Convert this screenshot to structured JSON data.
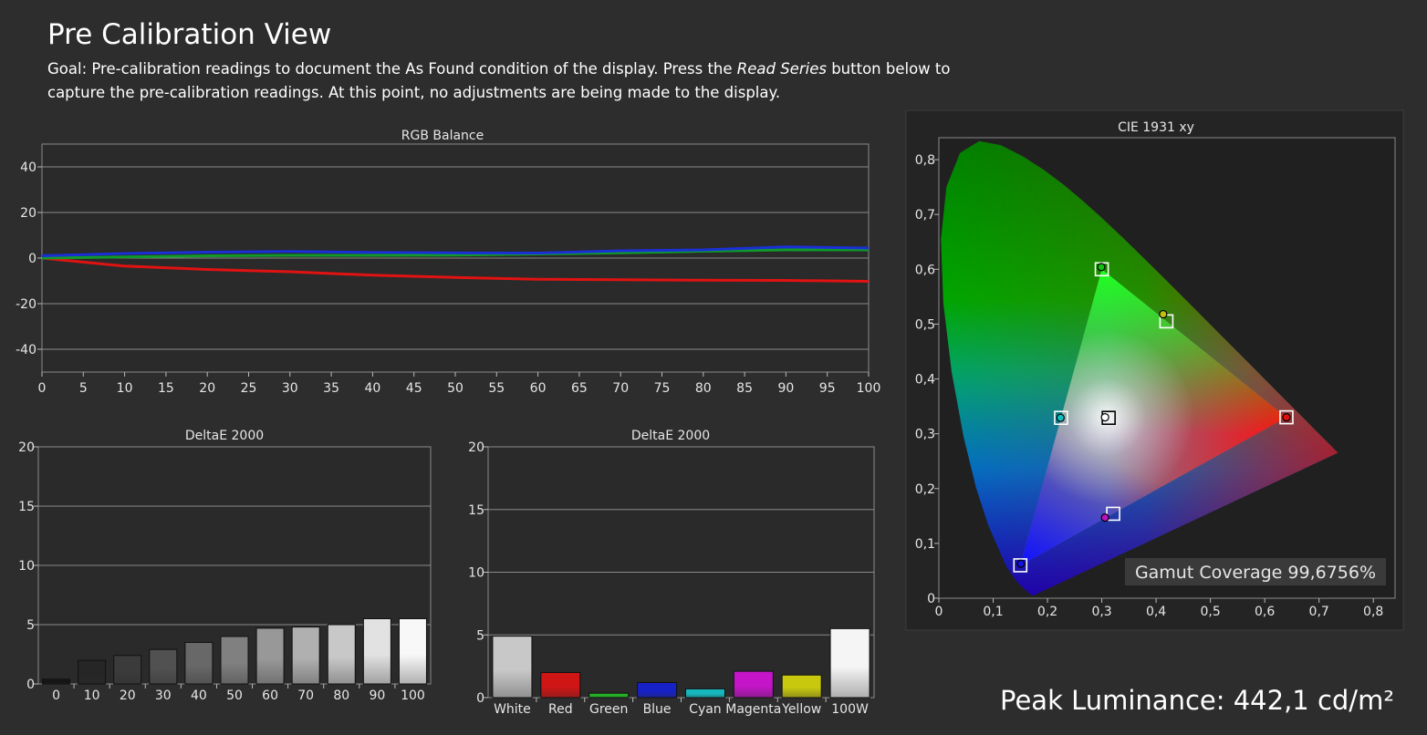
{
  "header": {
    "title": "Pre Calibration View",
    "goal_prefix": "Goal: Pre-calibration readings to document the As Found condition of the display. Press the ",
    "goal_button_ref": "Read Series",
    "goal_suffix": " button below to capture the pre-calibration readings. At this point, no adjustments are being made to the display."
  },
  "colors": {
    "background": "#2d2d2d",
    "plot_bg": "#2a2a2a",
    "red_series": "#e11212",
    "green_series": "#0f9a2a",
    "blue_series": "#1b2fd6"
  },
  "chart_data": [
    {
      "type": "line",
      "title": "RGB Balance",
      "x": [
        0,
        10,
        20,
        30,
        40,
        50,
        60,
        70,
        80,
        90,
        100
      ],
      "xticks": [
        "0",
        "5",
        "10",
        "15",
        "20",
        "25",
        "30",
        "35",
        "40",
        "45",
        "50",
        "55",
        "60",
        "65",
        "70",
        "75",
        "80",
        "85",
        "90",
        "95",
        "100"
      ],
      "yticks": [
        "40",
        "20",
        "0",
        "-20",
        "-40"
      ],
      "xlim": [
        0,
        100
      ],
      "ylim": [
        -50,
        50
      ],
      "grid": true,
      "series": [
        {
          "color": "#e11212",
          "values": [
            0,
            -3.5,
            -5,
            -6,
            -7.5,
            -8.5,
            -9.3,
            -9.5,
            -9.7,
            -9.8,
            -10.2
          ]
        },
        {
          "color": "#0f9a2a",
          "values": [
            0,
            0.5,
            1,
            1.2,
            1.2,
            1.3,
            1.8,
            2.3,
            3,
            3.6,
            3.6
          ]
        },
        {
          "color": "#1b2fd6",
          "values": [
            1,
            2,
            2.6,
            2.9,
            2.5,
            2.3,
            2.2,
            3.2,
            3.6,
            4.9,
            4.4
          ]
        }
      ]
    },
    {
      "type": "bar",
      "title": "DeltaE 2000",
      "categories": [
        "0",
        "10",
        "20",
        "30",
        "40",
        "50",
        "60",
        "70",
        "80",
        "90",
        "100"
      ],
      "values": [
        0.4,
        2.0,
        2.4,
        2.9,
        3.5,
        4.0,
        4.7,
        4.8,
        5.0,
        5.5,
        5.5
      ],
      "bar_colors": [
        "#151515",
        "#262626",
        "#3b3b3b",
        "#515151",
        "#686868",
        "#808080",
        "#989898",
        "#b0b0b0",
        "#c8c8c8",
        "#e2e2e2",
        "#f8f8f8"
      ],
      "yticks": [
        "20",
        "15",
        "10",
        "5",
        "0"
      ],
      "ylim": [
        0,
        20
      ],
      "grid": true
    },
    {
      "type": "bar",
      "title": "DeltaE 2000",
      "categories": [
        "White",
        "Red",
        "Green",
        "Blue",
        "Cyan",
        "Magenta",
        "Yellow",
        "100W"
      ],
      "values": [
        4.9,
        2.0,
        0.35,
        1.2,
        0.7,
        2.1,
        1.8,
        5.5
      ],
      "bar_colors": [
        "#c8c8c8",
        "#d01515",
        "#25b027",
        "#1622c8",
        "#17b7bf",
        "#c515c9",
        "#c8c80f",
        "#f5f5f5"
      ],
      "yticks": [
        "20",
        "15",
        "10",
        "5",
        "0"
      ],
      "ylim": [
        0,
        20
      ],
      "grid": true
    },
    {
      "type": "scatter",
      "title": "CIE 1931 xy",
      "xticks": [
        "0",
        "0,1",
        "0,2",
        "0,3",
        "0,4",
        "0,5",
        "0,6",
        "0,7",
        "0,8"
      ],
      "yticks": [
        "0,8",
        "0,7",
        "0,6",
        "0,5",
        "0,4",
        "0,3",
        "0,2",
        "0,1",
        "0"
      ],
      "xlim": [
        0,
        0.84
      ],
      "ylim": [
        0,
        0.84
      ],
      "targets": [
        {
          "x": 0.64,
          "y": 0.33
        },
        {
          "x": 0.3,
          "y": 0.6
        },
        {
          "x": 0.15,
          "y": 0.06
        },
        {
          "x": 0.225,
          "y": 0.329
        },
        {
          "x": 0.321,
          "y": 0.154
        },
        {
          "x": 0.419,
          "y": 0.505
        },
        {
          "x": 0.3127,
          "y": 0.329
        }
      ],
      "measured": [
        {
          "x": 0.64,
          "y": 0.33,
          "color": "#e01010"
        },
        {
          "x": 0.299,
          "y": 0.604,
          "color": "#10c010"
        },
        {
          "x": 0.151,
          "y": 0.063,
          "color": "#1010e0"
        },
        {
          "x": 0.224,
          "y": 0.329,
          "color": "#10c0c0"
        },
        {
          "x": 0.306,
          "y": 0.147,
          "color": "#c010c0"
        },
        {
          "x": 0.413,
          "y": 0.518,
          "color": "#c0c010"
        },
        {
          "x": 0.306,
          "y": 0.33,
          "color": "#ffffff"
        }
      ]
    }
  ],
  "cie": {
    "gamut_label": "Gamut Coverage 99,6756%"
  },
  "footer": {
    "peak_luminance": "Peak Luminance: 442,1 cd/m²"
  }
}
